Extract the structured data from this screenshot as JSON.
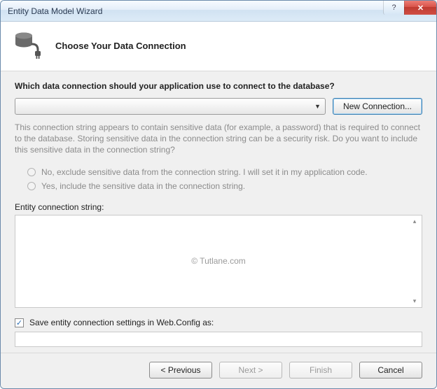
{
  "window": {
    "title": "Entity Data Model Wizard"
  },
  "header": {
    "title": "Choose Your Data Connection"
  },
  "body": {
    "prompt": "Which data connection should your application use to connect to the database?",
    "dropdown_value": "",
    "new_connection_label": "New Connection...",
    "info_text": "This connection string appears to contain sensitive data (for example, a password) that is required to connect to the database. Storing sensitive data in the connection string can be a security risk. Do you want to include this sensitive data in the connection string?",
    "radio_exclude": "No, exclude sensitive data from the connection string. I will set it in my application code.",
    "radio_include": "Yes, include the sensitive data in the connection string.",
    "entity_label": "Entity connection string:",
    "watermark": "© Tutlane.com",
    "save_checkbox_label": "Save entity connection settings in Web.Config as:",
    "save_checkbox_checked": true,
    "save_as_value": ""
  },
  "footer": {
    "previous": "< Previous",
    "next": "Next >",
    "finish": "Finish",
    "cancel": "Cancel"
  },
  "colors": {
    "accent": "#3c7fb1",
    "close": "#c03b31"
  }
}
